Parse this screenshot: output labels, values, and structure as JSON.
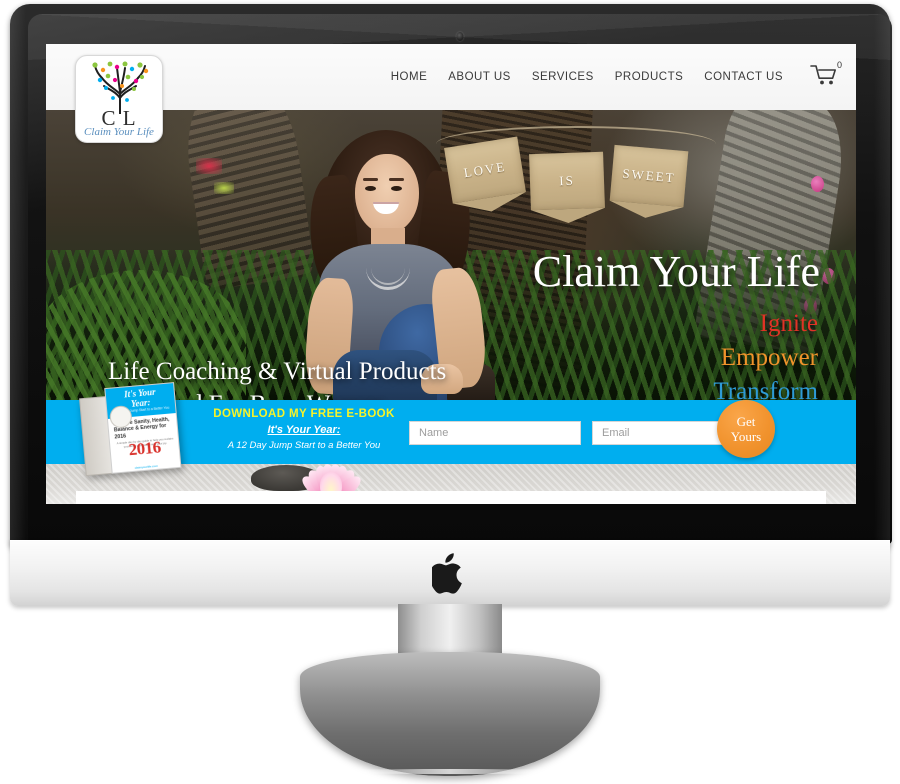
{
  "device": {
    "brand_logo": "apple-logo",
    "webcam": "webcam-dot"
  },
  "site": {
    "logo": {
      "initials": "C L",
      "tagline": "Claim Your Life"
    },
    "nav": {
      "items": [
        {
          "label": "HOME"
        },
        {
          "label": "ABOUT US"
        },
        {
          "label": "SERVICES"
        },
        {
          "label": "PRODUCTS"
        },
        {
          "label": "CONTACT US"
        }
      ],
      "cart": {
        "icon": "shopping-cart-icon",
        "count": "0"
      }
    },
    "hero": {
      "banner_flags": [
        "LOVE",
        "IS",
        "SWEET"
      ],
      "title": "Claim Your Life",
      "words": [
        {
          "text": "Ignite",
          "color": "#e03326"
        },
        {
          "text": "Empower",
          "color": "#f0932b"
        },
        {
          "text": "Transform",
          "color": "#2e9bd6"
        }
      ],
      "subheadline_line1": "Life Coaching & Virtual Products",
      "subheadline_line2": "Designed For Busy Women"
    },
    "optin": {
      "headline": "DOWNLOAD MY FREE E-BOOK",
      "book_title": "It's Your Year:",
      "book_subtitle": "A 12 Day Jump Start to a Better You",
      "name_placeholder": "Name",
      "name_value": "",
      "email_placeholder": "Email",
      "email_value": "",
      "button_line1": "Get",
      "button_line2": "Yours",
      "bar_color": "#00aeef",
      "button_color": "#f1932e",
      "headline_color": "#f6f32a"
    },
    "ebook_cover": {
      "title_line1": "It's Your",
      "title_line2": "Year:",
      "subtitle": "A 12 Day Jump Start to a Better You",
      "bullets": "Restore Sanity, Health, Balance & Energy for 2016",
      "body": "A simple day by day guide to help you reclaim your time, your health and your joy.",
      "year": "2016",
      "url": "claimyourlife.com"
    }
  }
}
